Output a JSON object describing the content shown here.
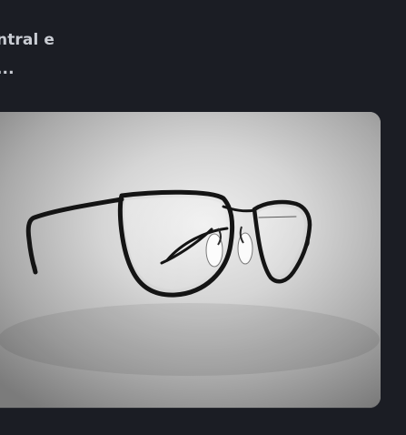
{
  "text": {
    "line1": "ntral e",
    "line2": "..."
  },
  "image": {
    "subject": "eyeglasses"
  }
}
